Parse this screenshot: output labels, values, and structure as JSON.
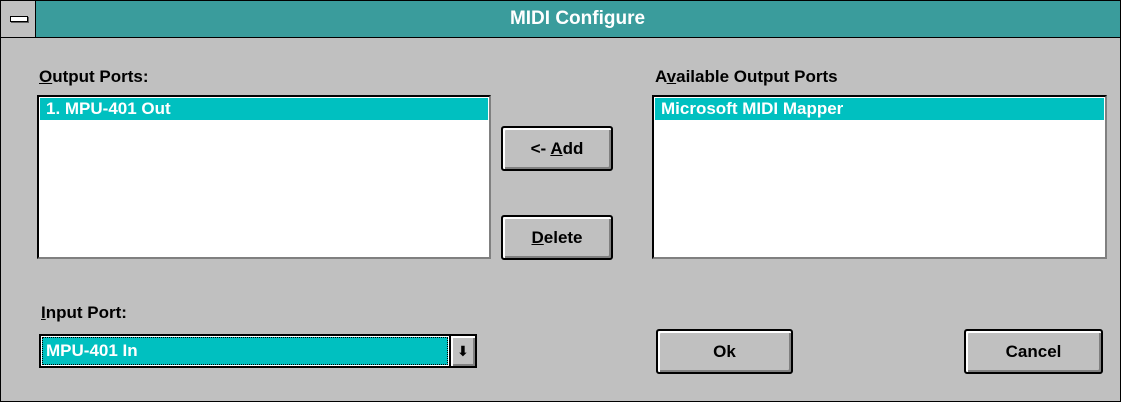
{
  "window": {
    "title": "MIDI Configure"
  },
  "output_ports": {
    "label_prefix": "",
    "label_accel": "O",
    "label_rest": "utput Ports:",
    "items": [
      "1. MPU-401 Out"
    ]
  },
  "available_ports": {
    "label_prefix": "A",
    "label_accel": "v",
    "label_rest": "ailable Output Ports",
    "items": [
      "Microsoft MIDI Mapper"
    ]
  },
  "buttons": {
    "add": {
      "prefix": "<- ",
      "accel": "A",
      "rest": "dd"
    },
    "delete": {
      "prefix": "",
      "accel": "D",
      "rest": "elete"
    },
    "ok": {
      "label": "Ok"
    },
    "cancel": {
      "label": "Cancel"
    }
  },
  "input_port": {
    "label_prefix": "",
    "label_accel": "I",
    "label_rest": "nput Port:",
    "value": "MPU-401 In",
    "arrow_glyph": "⬇"
  },
  "icons": {
    "system_menu": "system-menu-icon",
    "dropdown": "dropdown-arrow-icon"
  },
  "colors": {
    "titlebar": "#3a9c9c",
    "selection": "#00c0c0",
    "face": "#c0c0c0"
  }
}
